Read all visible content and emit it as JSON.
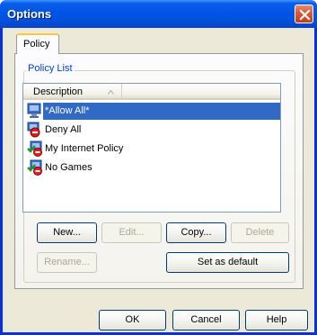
{
  "window": {
    "title": "Options",
    "close_label": "close"
  },
  "tabs": [
    {
      "label": "Policy",
      "active": true
    }
  ],
  "group": {
    "label": "Policy List"
  },
  "list": {
    "column_header": "Description",
    "sort": "ascending",
    "rows": [
      {
        "label": "*Allow All*",
        "icon": "allow-policy-icon",
        "selected": true
      },
      {
        "label": "Deny All",
        "icon": "deny-policy-icon",
        "selected": false
      },
      {
        "label": "My Internet Policy",
        "icon": "custom-policy-icon",
        "selected": false
      },
      {
        "label": "No Games",
        "icon": "custom-policy-icon",
        "selected": false
      }
    ]
  },
  "buttons": {
    "new": "New...",
    "edit": "Edit...",
    "copy": "Copy...",
    "delete": "Delete",
    "rename": "Rename...",
    "set_default": "Set as default"
  },
  "footer": {
    "ok": "OK",
    "cancel": "Cancel",
    "help": "Help"
  },
  "colors": {
    "titlebar": "#0055e5",
    "selection": "#316ac5",
    "group_label": "#0046d5",
    "dialog_face": "#ece9d8"
  }
}
